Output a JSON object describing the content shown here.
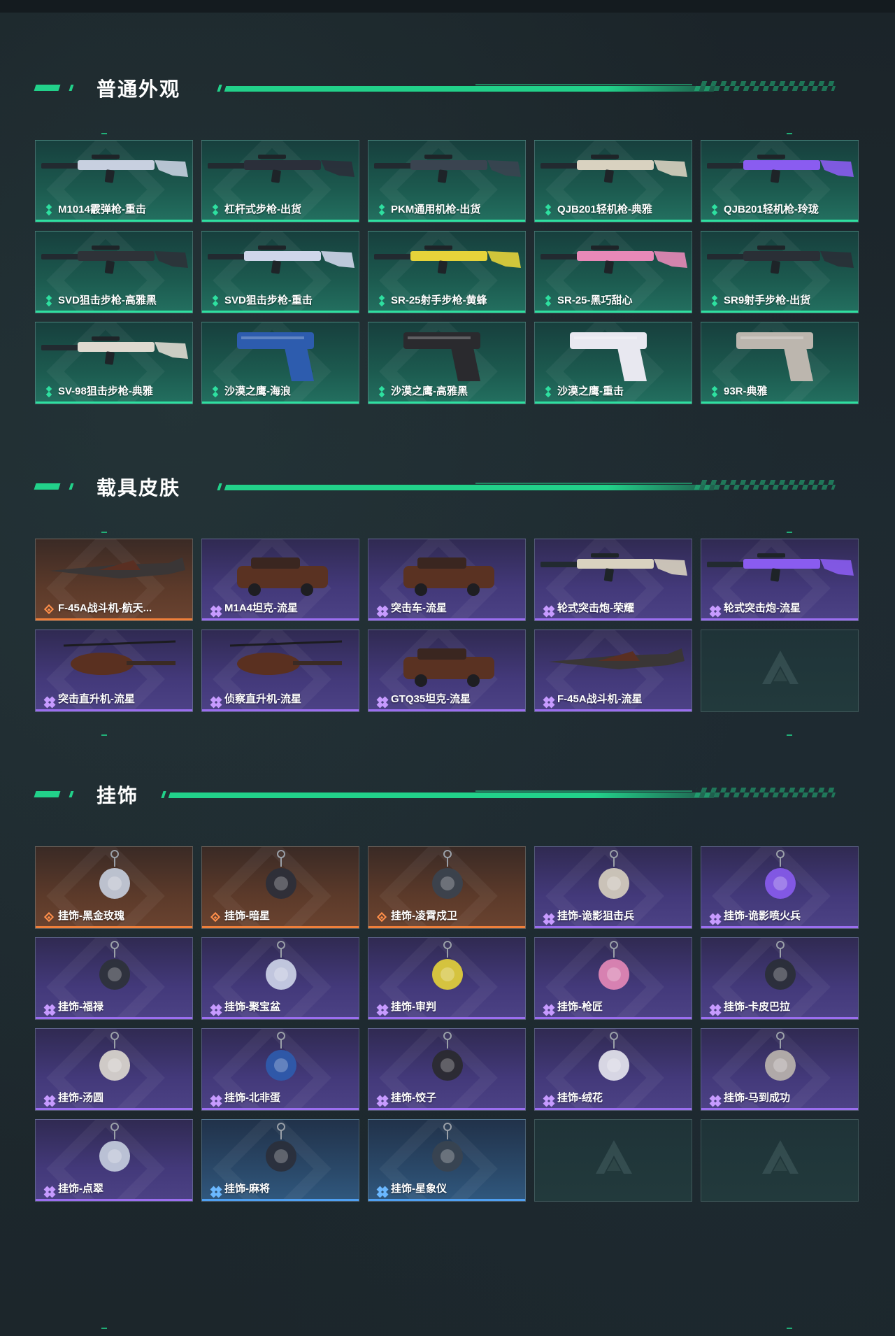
{
  "sections": [
    {
      "title": "普通外观",
      "items": [
        {
          "label": "M1014霰弹枪-重击",
          "rarity": "green",
          "icon": "shotgun-icon"
        },
        {
          "label": "杠杆式步枪-出货",
          "rarity": "green",
          "icon": "lever-rifle-icon"
        },
        {
          "label": "PKM通用机枪-出货",
          "rarity": "green",
          "icon": "machine-gun-icon"
        },
        {
          "label": "QJB201轻机枪-典雅",
          "rarity": "green",
          "icon": "light-machine-gun-icon"
        },
        {
          "label": "QJB201轻机枪-玲珑",
          "rarity": "green",
          "icon": "light-machine-gun-icon"
        },
        {
          "label": "SVD狙击步枪-高雅黑",
          "rarity": "green",
          "icon": "sniper-rifle-icon"
        },
        {
          "label": "SVD狙击步枪-重击",
          "rarity": "green",
          "icon": "sniper-rifle-icon"
        },
        {
          "label": "SR-25射手步枪-黄蜂",
          "rarity": "green",
          "icon": "marksman-rifle-icon"
        },
        {
          "label": "SR-25-黑巧甜心",
          "rarity": "green",
          "icon": "marksman-rifle-icon"
        },
        {
          "label": "SR9射手步枪-出货",
          "rarity": "green",
          "icon": "marksman-rifle-icon"
        },
        {
          "label": "SV-98狙击步枪-典雅",
          "rarity": "green",
          "icon": "sniper-rifle-icon"
        },
        {
          "label": "沙漠之鹰-海浪",
          "rarity": "green",
          "icon": "pistol-icon"
        },
        {
          "label": "沙漠之鹰-高雅黑",
          "rarity": "green",
          "icon": "pistol-icon"
        },
        {
          "label": "沙漠之鹰-重击",
          "rarity": "green",
          "icon": "pistol-icon"
        },
        {
          "label": "93R-典雅",
          "rarity": "green",
          "icon": "pistol-icon"
        }
      ]
    },
    {
      "title": "载具皮肤",
      "items": [
        {
          "label": "F-45A战斗机-航天...",
          "rarity": "orange",
          "icon": "fighter-jet-icon"
        },
        {
          "label": "M1A4坦克-流星",
          "rarity": "purple",
          "icon": "tank-icon"
        },
        {
          "label": "突击车-流星",
          "rarity": "purple",
          "icon": "assault-vehicle-icon"
        },
        {
          "label": "轮式突击炮-荣耀",
          "rarity": "purple",
          "icon": "wheeled-assault-gun-icon"
        },
        {
          "label": "轮式突击炮-流星",
          "rarity": "purple",
          "icon": "wheeled-assault-gun-icon"
        },
        {
          "label": "突击直升机-流星",
          "rarity": "purple",
          "icon": "attack-helicopter-icon"
        },
        {
          "label": "侦察直升机-流星",
          "rarity": "purple",
          "icon": "scout-helicopter-icon"
        },
        {
          "label": "GTQ35坦克-流星",
          "rarity": "purple",
          "icon": "tank-icon"
        },
        {
          "label": "F-45A战斗机-流星",
          "rarity": "purple",
          "icon": "fighter-jet-icon"
        },
        {
          "label": "",
          "rarity": "empty",
          "icon": "placeholder-logo-icon"
        }
      ]
    },
    {
      "title": "挂饰",
      "items": [
        {
          "label": "挂饰-黑金玫瑰",
          "rarity": "orange",
          "icon": "charm-icon"
        },
        {
          "label": "挂饰-暗星",
          "rarity": "orange",
          "icon": "charm-icon"
        },
        {
          "label": "挂饰-凌霄戍卫",
          "rarity": "orange",
          "icon": "charm-icon"
        },
        {
          "label": "挂饰-诡影狙击兵",
          "rarity": "purple",
          "icon": "charm-icon"
        },
        {
          "label": "挂饰-诡影喷火兵",
          "rarity": "purple",
          "icon": "charm-icon"
        },
        {
          "label": "挂饰-福禄",
          "rarity": "purple",
          "icon": "charm-icon"
        },
        {
          "label": "挂饰-聚宝盆",
          "rarity": "purple",
          "icon": "charm-icon"
        },
        {
          "label": "挂饰-审判",
          "rarity": "purple",
          "icon": "charm-icon"
        },
        {
          "label": "挂饰-枪匠",
          "rarity": "purple",
          "icon": "charm-icon"
        },
        {
          "label": "挂饰-卡皮巴拉",
          "rarity": "purple",
          "icon": "charm-icon"
        },
        {
          "label": "挂饰-汤圆",
          "rarity": "purple",
          "icon": "charm-icon"
        },
        {
          "label": "挂饰-北非蛋",
          "rarity": "purple",
          "icon": "charm-icon"
        },
        {
          "label": "挂饰-饺子",
          "rarity": "purple",
          "icon": "charm-icon"
        },
        {
          "label": "挂饰-绒花",
          "rarity": "purple",
          "icon": "charm-icon"
        },
        {
          "label": "挂饰-马到成功",
          "rarity": "purple",
          "icon": "charm-icon"
        },
        {
          "label": "挂饰-点翠",
          "rarity": "purple",
          "icon": "charm-icon"
        },
        {
          "label": "挂饰-麻将",
          "rarity": "blue",
          "icon": "charm-icon"
        },
        {
          "label": "挂饰-星象仪",
          "rarity": "blue",
          "icon": "charm-icon"
        },
        {
          "label": "",
          "rarity": "empty",
          "icon": "placeholder-logo-icon"
        },
        {
          "label": "",
          "rarity": "empty",
          "icon": "placeholder-logo-icon"
        }
      ]
    }
  ],
  "colors": {
    "accent": "#22d18a",
    "green": "#2ee0a0",
    "purple": "#9b6ef0",
    "orange": "#ef7f3a",
    "blue": "#4fa0f2"
  }
}
